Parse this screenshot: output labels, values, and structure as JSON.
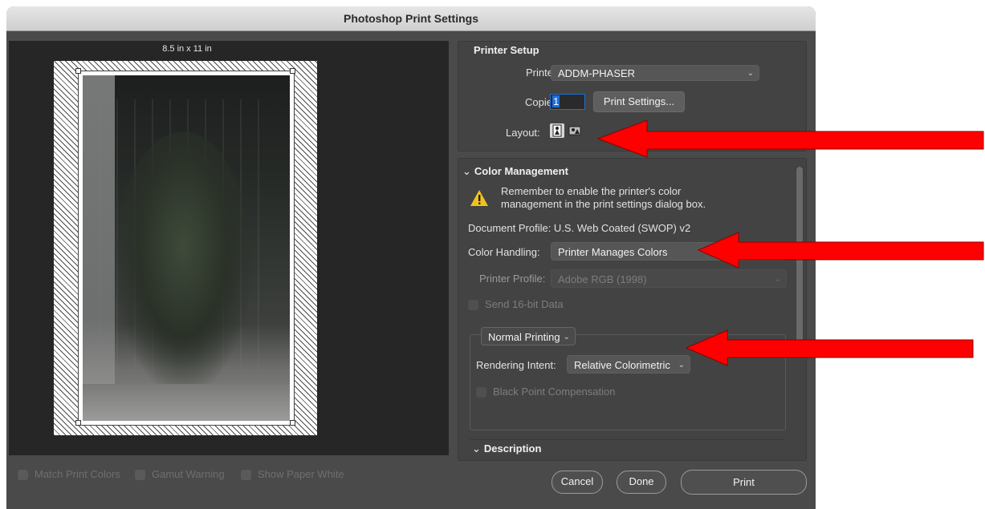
{
  "window": {
    "title": "Photoshop Print Settings"
  },
  "preview": {
    "paper_size": "8.5 in x 11 in",
    "options": [
      {
        "label": "Match Print Colors",
        "checked": false
      },
      {
        "label": "Gamut Warning",
        "checked": false
      },
      {
        "label": "Show Paper White",
        "checked": false
      }
    ]
  },
  "printer_setup": {
    "header": "Printer Setup",
    "printer_label": "Printer:",
    "printer_value": "ADDM-PHASER",
    "copies_label": "Copies:",
    "copies_value": "1",
    "print_settings_button": "Print Settings...",
    "layout_label": "Layout:"
  },
  "color_management": {
    "header": "Color Management",
    "warning": "Remember to enable the printer's color management in the print settings dialog box.",
    "document_profile": "Document Profile: U.S. Web Coated (SWOP) v2",
    "color_handling_label": "Color Handling:",
    "color_handling_value": "Printer Manages Colors",
    "printer_profile_label": "Printer Profile:",
    "printer_profile_value": "Adobe RGB (1998)",
    "send_16bit_label": "Send 16-bit Data",
    "printing_mode": "Normal Printing",
    "rendering_intent_label": "Rendering Intent:",
    "rendering_intent_value": "Relative Colorimetric",
    "black_point_label": "Black Point Compensation"
  },
  "description": {
    "header": "Description"
  },
  "buttons": {
    "cancel": "Cancel",
    "done": "Done",
    "print": "Print"
  },
  "colors": {
    "dialog_bg": "#4a4a4a",
    "preview_bg": "#262626",
    "arrow": "#ff0000",
    "warning": "#f2c21b"
  }
}
